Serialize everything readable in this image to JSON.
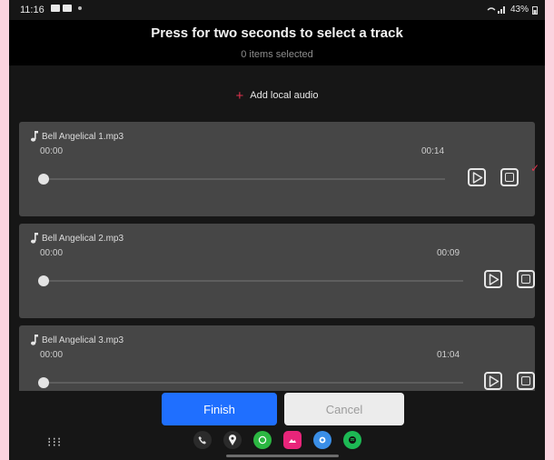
{
  "status_bar": {
    "time": "11:16",
    "battery": "43%"
  },
  "header": {
    "title": "Press for two seconds to select a track",
    "subtitle": "0 items selected"
  },
  "add_audio": {
    "label": "Add local audio"
  },
  "tracks": [
    {
      "name": "Bell Angelical 1.mp3",
      "start": "00:00",
      "end": "00:14",
      "selected": true
    },
    {
      "name": "Bell Angelical 2.mp3",
      "start": "00:00",
      "end": "00:09",
      "selected": false
    },
    {
      "name": "Bell Angelical 3.mp3",
      "start": "00:00",
      "end": "01:04",
      "selected": false
    }
  ],
  "buttons": {
    "finish": "Finish",
    "cancel": "Cancel"
  },
  "dock": {
    "apps": [
      {
        "icon": "phone-icon",
        "color": "#2b2b2b"
      },
      {
        "icon": "maps-pin-icon",
        "color": "#2b2b2b"
      },
      {
        "icon": "whatsapp-icon",
        "color": "#2cb742"
      },
      {
        "icon": "gallery-icon",
        "color": "#e8257a"
      },
      {
        "icon": "messages-icon",
        "color": "#3a8ee6"
      },
      {
        "icon": "spotify-icon",
        "color": "#1db954"
      }
    ]
  },
  "colors": {
    "accent": "#e0334d",
    "primary_button": "#1f6fff",
    "card": "#464646"
  }
}
